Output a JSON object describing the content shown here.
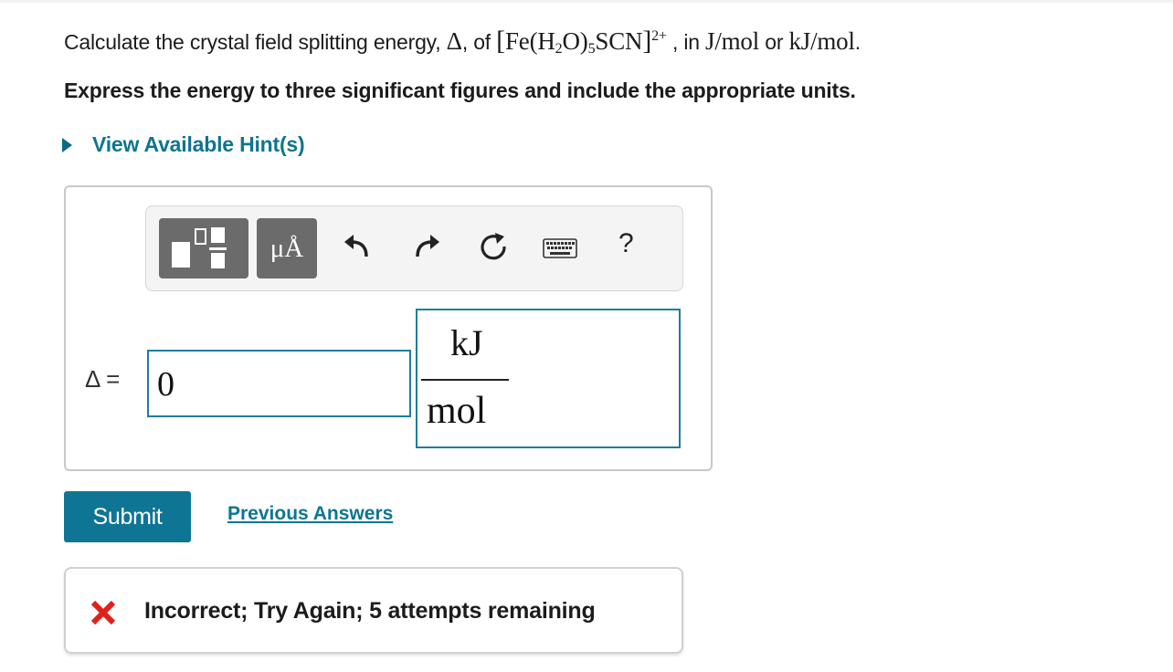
{
  "question": {
    "prefix": "Calculate the crystal field splitting energy, ",
    "delta_symbol": "Δ",
    "of_text": ", of ",
    "ion_Fe": "Fe",
    "ion_H": "(H",
    "ion_sub2": "2",
    "ion_O": "O)",
    "ion_sub5": "5",
    "ion_SCN": "SCN",
    "ion_charge": "2+",
    "in_text": " , in ",
    "unit1": "J/mol",
    "or_text": " or ",
    "unit2": "kJ/mol",
    "period": "."
  },
  "instructions": "Express the energy to three significant figures and include the appropriate units.",
  "hint_link": "View Available Hint(s)",
  "toolbar": {
    "units_button_label": "μÅ",
    "help_label": "?"
  },
  "answer": {
    "variable_label": "Δ =",
    "value": "0",
    "unit_numerator": "kJ",
    "unit_denominator": "mol"
  },
  "submit_label": "Submit",
  "previous_answers_label": "Previous Answers",
  "feedback": {
    "message": "Incorrect; Try Again; 5 attempts remaining",
    "status_color": "#e0201b"
  },
  "accent_color": "#0e7595"
}
